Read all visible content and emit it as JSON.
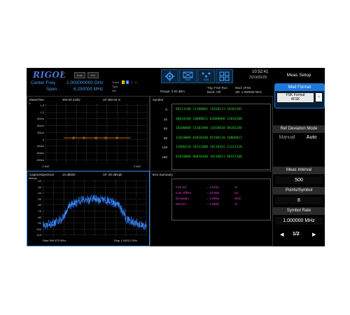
{
  "header": {
    "brand": "RIGOL",
    "btn_a": "Auto",
    "btn_b": "Ext",
    "center_freq_label": "Center Freq :",
    "center_freq_value": "1.000000000 GHz",
    "span_label": "Span :",
    "span_value": "6.250000 MHz",
    "trace_label": "Trace",
    "type_label": "Type",
    "det_label": "Det",
    "trace_numbers": [
      "1",
      "2",
      "3",
      "4"
    ],
    "range": "Range: 0.00 dBm",
    "trig": "Trig: Free Run",
    "burst": "Burst: Off",
    "mod": "Mod: 4FSK",
    "sr": "SR: 1.000000 MHz",
    "time": "10:52:41",
    "date": "2019/09/29",
    "mode_icon_2_label": "DMA",
    "mode_icon_3_label": "VSA",
    "accent_color": "#3fa0ff"
  },
  "meas_time": {
    "title": "MeasTime",
    "scale": "300.00 m/div",
    "ref": "ref 300.00 m",
    "y_unit": "V",
    "y_ticks": [
      "1.5",
      "1.2",
      "900m",
      "600m",
      "300m",
      "0",
      "-300m",
      "-600m",
      "-900m"
    ],
    "x_start": "-2.842",
    "x_end": "2.842"
  },
  "symbol": {
    "title": "Symbol",
    "rows": [
      {
        "index": "0",
        "bits": "00111100 11100001 11010111 10101101"
      },
      {
        "index": "32",
        "bits": "00010100 10000011 01000000 11010100"
      },
      {
        "index": "64",
        "bits": "10100000 11101000 11010010 00101100"
      },
      {
        "index": "96",
        "bits": "11010000 01010100 01100110 10000011"
      },
      {
        "index": "128",
        "bits": "11000110 10111000 10110101 11111110"
      },
      {
        "index": "160",
        "bits": "01010000 00010100 10110011 00111100"
      }
    ]
  },
  "capture": {
    "title": "CaptureSpectrum",
    "scale": "10 dB/div",
    "ref": "ref -20 dBVpk",
    "y_unit": "dBVpk",
    "y_ticks": [
      "-20",
      "-30",
      "-40",
      "-50",
      "-60",
      "-70",
      "-80",
      "-90",
      "-100",
      "-110"
    ],
    "start": "Start 996.875 MHz",
    "stop": "Stop 1.00312 GHz"
  },
  "errs": {
    "title": "Errs Summary",
    "rows": [
      {
        "label": "FSK Err",
        "value": "= 2.5781",
        "unit": "%"
      },
      {
        "label": "Carr Offset",
        "value": "= 23.935",
        "unit": "Hz"
      },
      {
        "label": "Deviation",
        "value": "= 1.0005",
        "unit": "MHz"
      },
      {
        "label": "Dev Err",
        "value": "= 2.5653",
        "unit": "%"
      }
    ]
  },
  "menu": {
    "title": "Meas Setup",
    "mod_format_label": "Mod Format",
    "mod_format_value_1": "FSK Format",
    "mod_format_value_2": "4FSK",
    "ref_dev_label": "Ref Deviation Mode",
    "ref_dev_manual": "Manual",
    "ref_dev_auto": "Auto",
    "meas_interval_label": "Meas Interval",
    "meas_interval_value": "500",
    "points_label": "Points/Symbol",
    "points_value": "8",
    "symbol_rate_label": "Symbol Rate",
    "symbol_rate_value": "1.000000 MHz",
    "page": "1/2"
  }
}
